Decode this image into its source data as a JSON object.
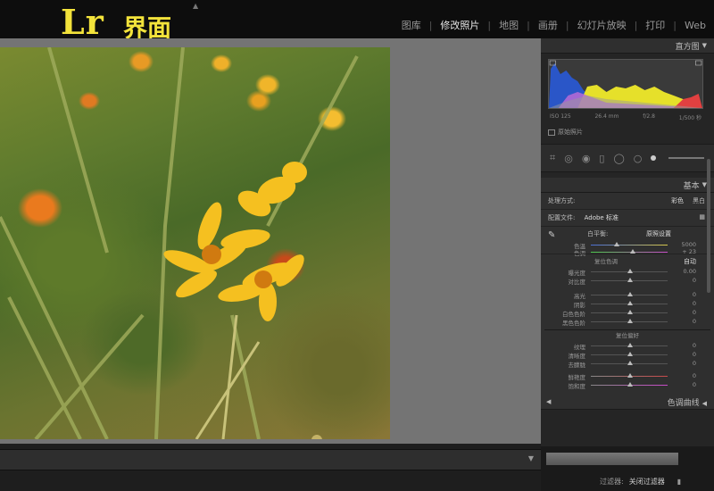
{
  "header": {
    "logo_lr": "Lr",
    "logo_text": "界面",
    "modules": [
      "图库",
      "修改照片",
      "地图",
      "画册",
      "幻灯片放映",
      "打印",
      "Web"
    ],
    "active_module": "修改照片"
  },
  "panel": {
    "histogram_title": "直方图",
    "histogram_info": {
      "iso": "ISO 125",
      "focal": "26.4 mm",
      "aperture": "f/2.8",
      "shutter": "1/500 秒"
    },
    "original_photo_label": "原始照片",
    "basic_title": "基本",
    "treatment_label": "处理方式:",
    "treatment_color": "彩色",
    "treatment_bw": "黑白",
    "profile_label": "配置文件:",
    "profile_value": "Adobe 标准",
    "wb_label": "白平衡:",
    "wb_value": "原照设置",
    "temp_label": "色温",
    "temp_value": "5000",
    "tint_label": "色调",
    "tint_value": "+ 23",
    "tone_title": "复位色调",
    "auto_label": "自动",
    "exposure_label": "曝光度",
    "exposure_value": "0.00",
    "contrast_label": "对比度",
    "contrast_value": "0",
    "highlights_label": "高光",
    "highlights_value": "0",
    "shadows_label": "阴影",
    "shadows_value": "0",
    "whites_label": "白色色阶",
    "whites_value": "0",
    "blacks_label": "黑色色阶",
    "blacks_value": "0",
    "presence_title": "复位偏好",
    "texture_label": "纹理",
    "texture_value": "0",
    "clarity_label": "清晰度",
    "clarity_value": "0",
    "dehaze_label": "去朦胧",
    "dehaze_value": "0",
    "vibrance_label": "鲜艳度",
    "vibrance_value": "0",
    "saturation_label": "饱和度",
    "saturation_value": "0",
    "tone_curve_title": "色调曲线"
  },
  "footer": {
    "filter_label": "过滤器:",
    "filter_value": "关闭过滤器"
  },
  "colors": {
    "logo": "#f3e33b",
    "viewer_bg": "#747474"
  }
}
